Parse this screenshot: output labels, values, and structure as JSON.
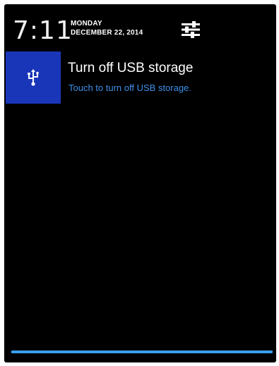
{
  "status_header": {
    "time": "7:11",
    "day": "MONDAY",
    "date": "DECEMBER 22, 2014",
    "settings_icon": "quick-settings-icon"
  },
  "notification": {
    "icon": "usb-icon",
    "title": "Turn off USB storage",
    "text": "Touch to turn off USB storage.",
    "icon_bg_color": "#1a36b8",
    "text_color": "#3e8fe8"
  },
  "colors": {
    "background": "#000000",
    "accent": "#3a9ff0"
  }
}
